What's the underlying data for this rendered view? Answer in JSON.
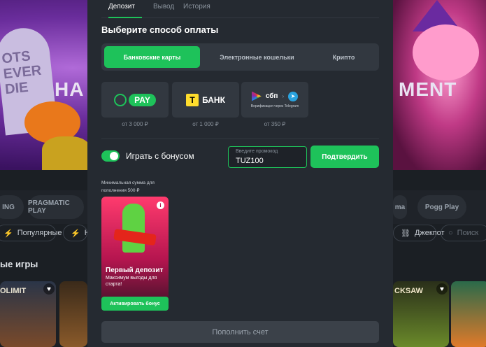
{
  "background": {
    "banner_left_text": "HA",
    "banner_right_text": "MENT",
    "tomb_text": "OTS EVER DIE",
    "providers": [
      "ING",
      "PRAGMATIC PLAY",
      "ma",
      "Pogg Play"
    ],
    "categories": [
      "Популярные",
      "Н",
      "Джекпот",
      "Поиск"
    ],
    "section_title": "ые игры",
    "tile_labels": [
      "OLIMIT",
      "CKSAW"
    ]
  },
  "modal": {
    "tabs": [
      "Депозит",
      "Вывод",
      "История"
    ],
    "heading": "Выберите способ оплаты",
    "segments": [
      "Банковские карты",
      "Электронные кошельки",
      "Крипто"
    ],
    "methods": [
      {
        "name": "PAY",
        "min": "от 3 000 ₽"
      },
      {
        "name": "БАНК",
        "min": "от 1 000 ₽"
      },
      {
        "name": "сбп",
        "sub": "Верификация через Telegram",
        "min": "от 350 ₽"
      }
    ],
    "bonus_toggle_label": "Играть с бонусом",
    "promo": {
      "placeholder": "Введите промокод",
      "value": "TUZ100"
    },
    "confirm_label": "Подтвердить",
    "min_sum": "Минимальная сумма для пополнения 500 ₽",
    "bonus_card": {
      "title": "Первый депозит",
      "subtitle": "Максимум выгоды для старта!",
      "button": "Активировать бонус"
    },
    "deposit_button": "Пополнить счет"
  },
  "colors": {
    "accent": "#1ec25a",
    "modal_bg": "#252a31",
    "panel": "#323840"
  }
}
